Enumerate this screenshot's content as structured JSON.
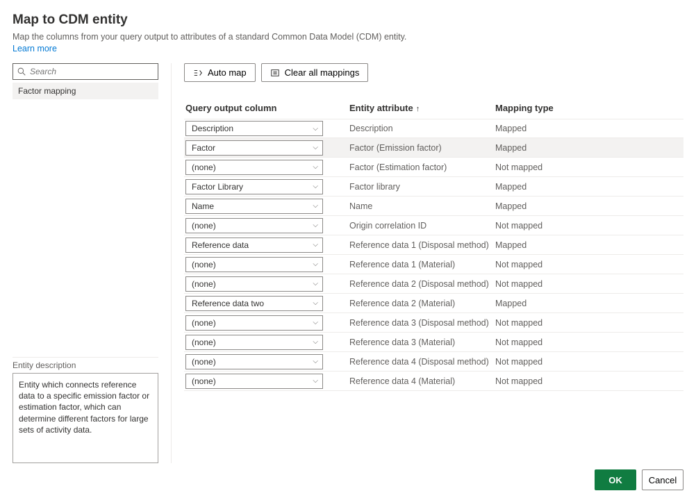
{
  "header": {
    "title": "Map to CDM entity",
    "subtitle": "Map the columns from your query output to attributes of a standard Common Data Model (CDM) entity.",
    "learn_more": "Learn more"
  },
  "sidebar": {
    "search_placeholder": "Search",
    "selected_entity": "Factor mapping",
    "desc_label": "Entity description",
    "desc_text": "Entity which connects reference data to a specific emission factor or estimation factor, which can determine different factors for large sets of activity data."
  },
  "toolbar": {
    "auto_map": "Auto map",
    "clear_all": "Clear all mappings"
  },
  "table": {
    "col1": "Query output column",
    "col2": "Entity attribute",
    "col3": "Mapping type"
  },
  "rows": [
    {
      "output": "Description",
      "attr": "Description",
      "type": "Mapped",
      "sel": false
    },
    {
      "output": "Factor",
      "attr": "Factor (Emission factor)",
      "type": "Mapped",
      "sel": true
    },
    {
      "output": "(none)",
      "attr": "Factor (Estimation factor)",
      "type": "Not mapped",
      "sel": false
    },
    {
      "output": "Factor Library",
      "attr": "Factor library",
      "type": "Mapped",
      "sel": false
    },
    {
      "output": "Name",
      "attr": "Name",
      "type": "Mapped",
      "sel": false
    },
    {
      "output": "(none)",
      "attr": "Origin correlation ID",
      "type": "Not mapped",
      "sel": false
    },
    {
      "output": "Reference data",
      "attr": "Reference data 1 (Disposal method)",
      "type": "Mapped",
      "sel": false
    },
    {
      "output": "(none)",
      "attr": "Reference data 1 (Material)",
      "type": "Not mapped",
      "sel": false
    },
    {
      "output": "(none)",
      "attr": "Reference data 2 (Disposal method)",
      "type": "Not mapped",
      "sel": false
    },
    {
      "output": "Reference data two",
      "attr": "Reference data 2 (Material)",
      "type": "Mapped",
      "sel": false
    },
    {
      "output": "(none)",
      "attr": "Reference data 3 (Disposal method)",
      "type": "Not mapped",
      "sel": false
    },
    {
      "output": "(none)",
      "attr": "Reference data 3 (Material)",
      "type": "Not mapped",
      "sel": false
    },
    {
      "output": "(none)",
      "attr": "Reference data 4 (Disposal method)",
      "type": "Not mapped",
      "sel": false
    },
    {
      "output": "(none)",
      "attr": "Reference data 4 (Material)",
      "type": "Not mapped",
      "sel": false
    }
  ],
  "footer": {
    "ok": "OK",
    "cancel": "Cancel"
  }
}
